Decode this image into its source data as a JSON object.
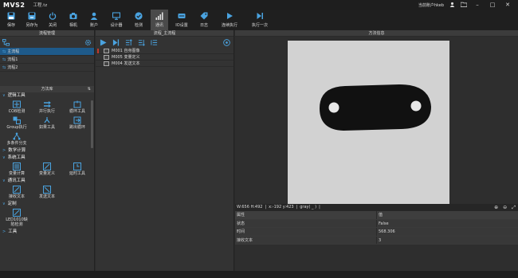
{
  "app": {
    "logo": "MVS2",
    "project": "工程.tz",
    "user": "当前账户hkeb"
  },
  "toolbar": [
    {
      "label": "保存",
      "icon": "save-icon"
    },
    {
      "label": "另存为",
      "icon": "save-as-icon"
    },
    {
      "label": "关闭",
      "icon": "power-icon"
    },
    {
      "label": "相机",
      "icon": "camera-icon"
    },
    {
      "label": "账户",
      "icon": "user-icon"
    },
    {
      "label": "设计器",
      "icon": "monitor-icon"
    },
    {
      "label": "检测",
      "icon": "check-icon"
    },
    {
      "label": "通讯",
      "icon": "signal-icon"
    },
    {
      "label": "IO设置",
      "icon": "io-icon"
    },
    {
      "label": "日志",
      "icon": "tag-icon"
    },
    {
      "label": "连续执行",
      "icon": "play-icon"
    },
    {
      "label": "执行一次",
      "icon": "step-icon"
    }
  ],
  "left": {
    "title": "流程管理",
    "flows": [
      "主流程",
      "流程1",
      "流程2"
    ],
    "library_title": "方法库",
    "categories": [
      {
        "name": "逻辑工具",
        "tools": [
          "COB检测",
          "并行执行",
          "循环工具",
          "Group执行",
          "如果工具",
          "跳出循环",
          "多条件分支"
        ]
      },
      {
        "name": "数学计算",
        "tools": []
      },
      {
        "name": "系统工具",
        "tools": [
          "变量计算",
          "变量定义",
          "延时工具"
        ]
      },
      {
        "name": "通讯工具",
        "tools": [
          "接收文本",
          "发送文本"
        ]
      },
      {
        "name": "定制",
        "tools": [
          "LED1010缺陷检测"
        ]
      },
      {
        "name": "工具",
        "tools": []
      }
    ]
  },
  "middle": {
    "title": "流程_主流程",
    "modules": [
      "M001 自身图像",
      "M005 变量定义",
      "M004 发送文本"
    ]
  },
  "right": {
    "title": "方法信息",
    "info": {
      "size": "W:656 H:492",
      "pos": "x:-192 y:423",
      "gray": "gray( _ )"
    },
    "table": {
      "headers": [
        "属性",
        "值"
      ],
      "rows": [
        [
          "状态",
          "False"
        ],
        [
          "时间",
          "568.306"
        ],
        [
          "接收文本",
          "3"
        ]
      ]
    }
  },
  "colors": {
    "accent": "#4aa3e0",
    "selected": "#1e5a8a"
  }
}
